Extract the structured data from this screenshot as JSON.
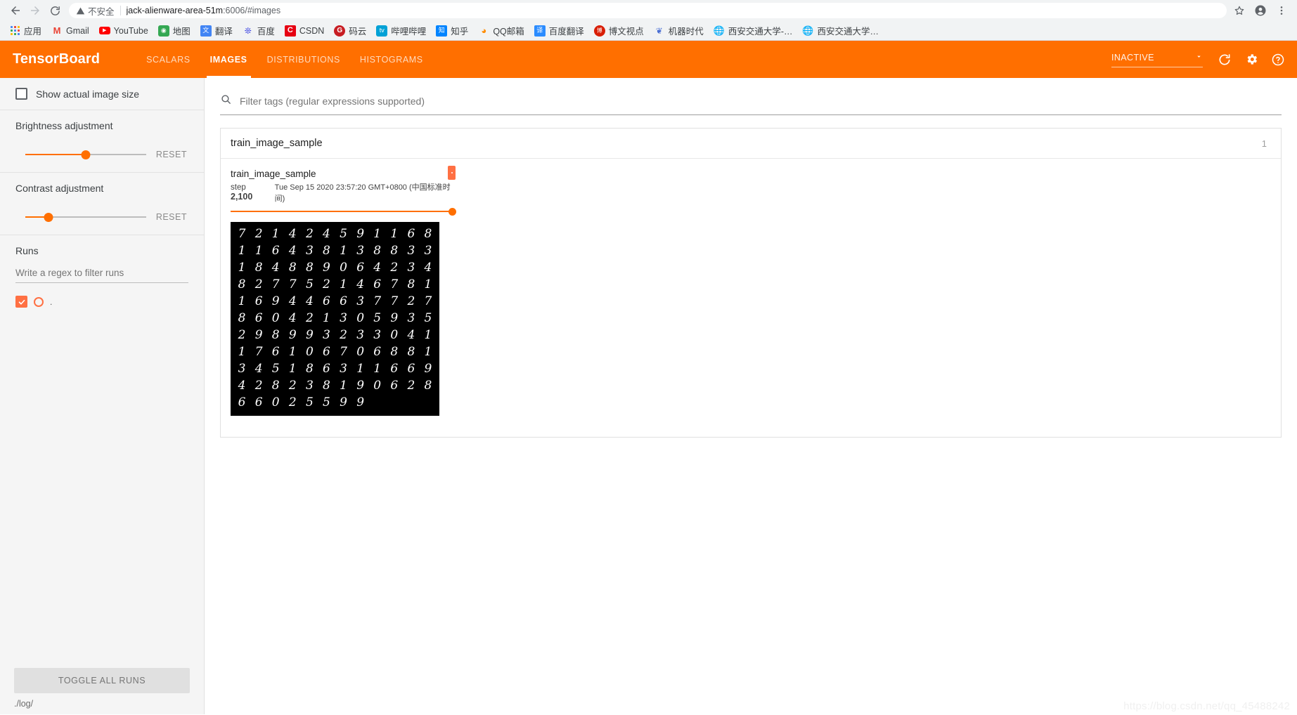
{
  "browser": {
    "back_icon": "arrow-left-icon",
    "forward_icon": "arrow-right-icon",
    "reload_icon": "reload-icon",
    "security_label": "不安全",
    "url_host": "jack-alienware-area-51m",
    "url_rest": ":6006/#images",
    "bookmark_star_icon": "star-icon",
    "profile_icon": "profile-icon",
    "menu_icon": "kebab-menu-icon",
    "bookmarks": [
      {
        "label": "应用",
        "icon": "apps-grid-icon",
        "glyph": "",
        "fg": "#ffffff",
        "bg": ""
      },
      {
        "label": "Gmail",
        "icon": "gmail-icon",
        "glyph": "M",
        "fg": "#ea4335",
        "bg": ""
      },
      {
        "label": "YouTube",
        "icon": "youtube-icon",
        "glyph": "▶",
        "fg": "#ffffff",
        "bg": "#ff0000"
      },
      {
        "label": "地图",
        "icon": "google-maps-icon",
        "glyph": "📍",
        "fg": "#34a853",
        "bg": ""
      },
      {
        "label": "翻译",
        "icon": "google-translate-icon",
        "glyph": "文",
        "fg": "#ffffff",
        "bg": "#4285f4"
      },
      {
        "label": "百度",
        "icon": "baidu-icon",
        "glyph": "熊",
        "fg": "#2932e1",
        "bg": ""
      },
      {
        "label": "CSDN",
        "icon": "csdn-icon",
        "glyph": "C",
        "fg": "#ffffff",
        "bg": "#e60012"
      },
      {
        "label": "码云",
        "icon": "gitee-icon",
        "glyph": "G",
        "fg": "#ffffff",
        "bg": "#c71d23"
      },
      {
        "label": "哔哩哔哩",
        "icon": "bilibili-icon",
        "glyph": "▢",
        "fg": "#ffffff",
        "bg": "#00a1d6"
      },
      {
        "label": "知乎",
        "icon": "zhihu-icon",
        "glyph": "知",
        "fg": "#ffffff",
        "bg": "#0084ff"
      },
      {
        "label": "QQ邮箱",
        "icon": "qq-mail-icon",
        "glyph": "◐",
        "fg": "#ff8c00",
        "bg": ""
      },
      {
        "label": "百度翻译",
        "icon": "baidu-translate-icon",
        "glyph": "译",
        "fg": "#ffffff",
        "bg": "#2b8cff"
      },
      {
        "label": "博文视点",
        "icon": "bowen-icon",
        "glyph": "博",
        "fg": "#ffffff",
        "bg": "#d81e06"
      },
      {
        "label": "机器时代",
        "icon": "jiqi-shidai-icon",
        "glyph": "♆",
        "fg": "#4a6fd4",
        "bg": ""
      },
      {
        "label": "西安交通大学-…",
        "icon": "globe-icon",
        "glyph": "🌐",
        "fg": "#5f6368",
        "bg": ""
      },
      {
        "label": "西安交通大学…",
        "icon": "globe-icon",
        "glyph": "🌐",
        "fg": "#5f6368",
        "bg": ""
      }
    ]
  },
  "tensorboard": {
    "logo": "TensorBoard",
    "accent_color": "#ff6f00",
    "tabs": [
      {
        "label": "SCALARS",
        "active": false
      },
      {
        "label": "IMAGES",
        "active": true
      },
      {
        "label": "DISTRIBUTIONS",
        "active": false
      },
      {
        "label": "HISTOGRAMS",
        "active": false
      }
    ],
    "status_select": {
      "value": "INACTIVE",
      "caret_icon": "chevron-down-icon"
    },
    "reload_icon": "refresh-icon",
    "settings_icon": "gear-icon",
    "help_icon": "help-circle-icon"
  },
  "sidebar": {
    "show_actual_size": {
      "label": "Show actual image size",
      "checked": false
    },
    "brightness": {
      "title": "Brightness adjustment",
      "reset_label": "RESET",
      "value_percent": 50
    },
    "contrast": {
      "title": "Contrast adjustment",
      "reset_label": "RESET",
      "value_percent": 19
    },
    "runs": {
      "title": "Runs",
      "filter_placeholder": "Write a regex to filter runs",
      "filter_value": "",
      "items": [
        {
          "name": ".",
          "checked": true,
          "color": "#ff7043"
        }
      ]
    },
    "toggle_all_label": "TOGGLE ALL RUNS",
    "logdir": "./log/"
  },
  "main": {
    "filter": {
      "placeholder": "Filter tags (regular expressions supported)",
      "value": "",
      "search_icon": "search-icon"
    },
    "tag_group": {
      "title": "train_image_sample",
      "count": "1"
    },
    "image_card": {
      "title": "train_image_sample",
      "step_label": "step",
      "step_value": "2,100",
      "wall_time": "Tue Sep 15 2020 23:57:20 GMT+0800 (中国标准时间)",
      "pin_icon": "pin-icon",
      "slider_position_percent": 100,
      "mnist_grid": {
        "columns": 12,
        "rows": 12,
        "digits": [
          [
            "7",
            "2",
            "1",
            "4",
            "2",
            "4",
            "5",
            "9",
            "1",
            "1",
            "6",
            "8"
          ],
          [
            "1",
            "1",
            "6",
            "4",
            "3",
            "8",
            "1",
            "3",
            "8",
            "8",
            "3",
            "3"
          ],
          [
            "1",
            "8",
            "4",
            "8",
            "8",
            "9",
            "0",
            "6",
            "4",
            "2",
            "3",
            "4"
          ],
          [
            "8",
            "2",
            "7",
            "7",
            "5",
            "2",
            "1",
            "4",
            "6",
            "7",
            "8",
            "1"
          ],
          [
            "1",
            "6",
            "9",
            "4",
            "4",
            "6",
            "6",
            "3",
            "7",
            "7",
            "2",
            "7"
          ],
          [
            "8",
            "6",
            "0",
            "4",
            "2",
            "1",
            "3",
            "0",
            "5",
            "9",
            "3",
            "5"
          ],
          [
            "2",
            "9",
            "8",
            "9",
            "9",
            "3",
            "2",
            "3",
            "3",
            "0",
            "4",
            "1"
          ],
          [
            "1",
            "7",
            "6",
            "1",
            "0",
            "6",
            "7",
            "0",
            "6",
            "8",
            "8",
            "1"
          ],
          [
            "3",
            "4",
            "5",
            "1",
            "8",
            "6",
            "3",
            "1",
            "1",
            "6",
            "6",
            "9"
          ],
          [
            "4",
            "2",
            "8",
            "2",
            "3",
            "8",
            "1",
            "9",
            "0",
            "6",
            "2",
            "8"
          ],
          [
            "6",
            "6",
            "0",
            "2",
            "5",
            "5",
            "9",
            "9",
            "",
            "",
            "",
            ""
          ]
        ]
      }
    }
  },
  "watermark": "https://blog.csdn.net/qq_45488242"
}
